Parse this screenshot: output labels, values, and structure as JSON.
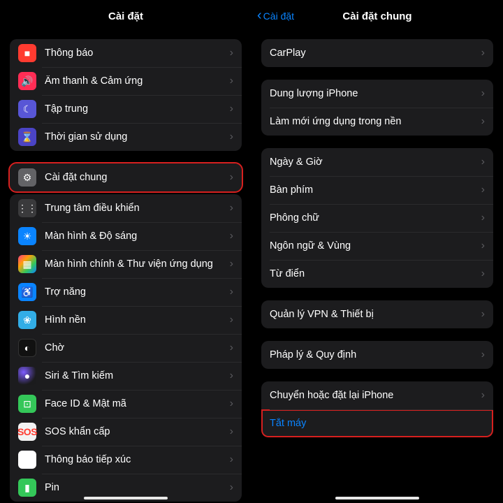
{
  "left": {
    "title": "Cài đặt",
    "groups": [
      [
        {
          "icon": "notification-icon",
          "bg": "bg-red",
          "glyph": "■",
          "label": "Thông báo"
        },
        {
          "icon": "sound-icon",
          "bg": "bg-pink",
          "glyph": "🔊",
          "label": "Âm thanh & Cảm ứng"
        },
        {
          "icon": "focus-icon",
          "bg": "bg-purple",
          "glyph": "☾",
          "label": "Tập trung"
        },
        {
          "icon": "screentime-icon",
          "bg": "bg-indigo",
          "glyph": "⌛",
          "label": "Thời gian sử dụng"
        }
      ],
      [
        {
          "icon": "general-icon",
          "bg": "bg-gray",
          "glyph": "⚙",
          "label": "Cài đặt chung",
          "highlight": true
        },
        {
          "icon": "control-center-icon",
          "bg": "bg-darkg",
          "glyph": "⋮⋮",
          "label": "Trung tâm điều khiển"
        },
        {
          "icon": "display-icon",
          "bg": "bg-blue",
          "glyph": "☀",
          "label": "Màn hình & Độ sáng"
        },
        {
          "icon": "homescreen-icon",
          "bg": "bg-multi",
          "glyph": "▦",
          "label": "Màn hình chính & Thư viện ứng dụng"
        },
        {
          "icon": "accessibility-icon",
          "bg": "bg-blue",
          "glyph": "♿",
          "label": "Trợ năng"
        },
        {
          "icon": "wallpaper-icon",
          "bg": "bg-cyan",
          "glyph": "❀",
          "label": "Hình nền"
        },
        {
          "icon": "standby-icon",
          "bg": "bg-black",
          "glyph": "◐",
          "label": "Chờ"
        },
        {
          "icon": "siri-icon",
          "bg": "bg-siri",
          "glyph": "●",
          "label": "Siri & Tìm kiếm"
        },
        {
          "icon": "faceid-icon",
          "bg": "bg-green",
          "glyph": "⊡",
          "label": "Face ID & Mật mã"
        },
        {
          "icon": "sos-icon",
          "bg": "bg-white",
          "glyph": "SOS",
          "label": "SOS khẩn cấp",
          "sos": true
        },
        {
          "icon": "exposure-icon",
          "bg": "bg-expos",
          "glyph": "✳",
          "label": "Thông báo tiếp xúc"
        },
        {
          "icon": "battery-icon",
          "bg": "bg-green",
          "glyph": "▮",
          "label": "Pin"
        }
      ]
    ]
  },
  "right": {
    "back_label": "Cài đặt",
    "title": "Cài đặt chung",
    "groups": [
      [
        {
          "label": "CarPlay"
        }
      ],
      [
        {
          "label": "Dung lượng iPhone"
        },
        {
          "label": "Làm mới ứng dụng trong nền"
        }
      ],
      [
        {
          "label": "Ngày & Giờ"
        },
        {
          "label": "Bàn phím"
        },
        {
          "label": "Phông chữ"
        },
        {
          "label": "Ngôn ngữ & Vùng"
        },
        {
          "label": "Từ điển"
        }
      ],
      [
        {
          "label": "Quản lý VPN & Thiết bị"
        }
      ],
      [
        {
          "label": "Pháp lý & Quy định"
        }
      ],
      [
        {
          "label": "Chuyển hoặc đặt lại iPhone"
        },
        {
          "label": "Tắt máy",
          "blue": true,
          "no_chevron": true,
          "highlight": true
        }
      ]
    ]
  }
}
